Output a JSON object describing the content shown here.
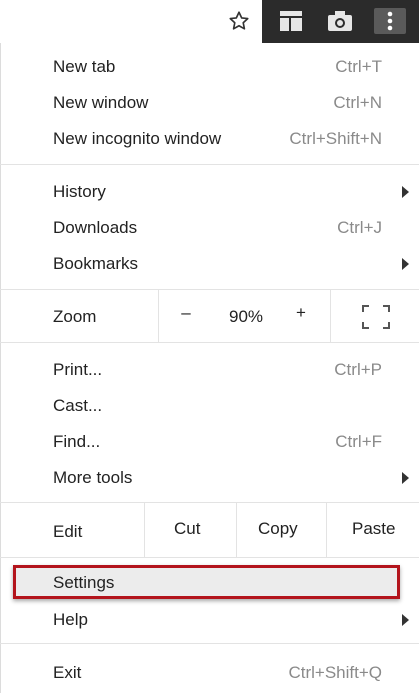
{
  "toolbar": {
    "icons": [
      "star-icon",
      "panel-icon",
      "camera-icon",
      "kebab-menu-icon"
    ]
  },
  "menu": {
    "new_tab": {
      "label": "New tab",
      "shortcut": "Ctrl+T"
    },
    "new_window": {
      "label": "New window",
      "shortcut": "Ctrl+N"
    },
    "new_incognito": {
      "label": "New incognito window",
      "shortcut": "Ctrl+Shift+N"
    },
    "history": {
      "label": "History"
    },
    "downloads": {
      "label": "Downloads",
      "shortcut": "Ctrl+J"
    },
    "bookmarks": {
      "label": "Bookmarks"
    },
    "zoom": {
      "label": "Zoom",
      "minus": "–",
      "value": "90%",
      "plus": "+"
    },
    "print": {
      "label": "Print...",
      "shortcut": "Ctrl+P"
    },
    "cast": {
      "label": "Cast..."
    },
    "find": {
      "label": "Find...",
      "shortcut": "Ctrl+F"
    },
    "more_tools": {
      "label": "More tools"
    },
    "edit": {
      "label": "Edit",
      "cut": "Cut",
      "copy": "Copy",
      "paste": "Paste"
    },
    "settings": {
      "label": "Settings"
    },
    "help": {
      "label": "Help"
    },
    "exit": {
      "label": "Exit",
      "shortcut": "Ctrl+Shift+Q"
    }
  },
  "colors": {
    "highlight_border": "#b3141c",
    "toolbar_dark": "#2b2b2b",
    "shortcut_gray": "#8a8a8a"
  }
}
